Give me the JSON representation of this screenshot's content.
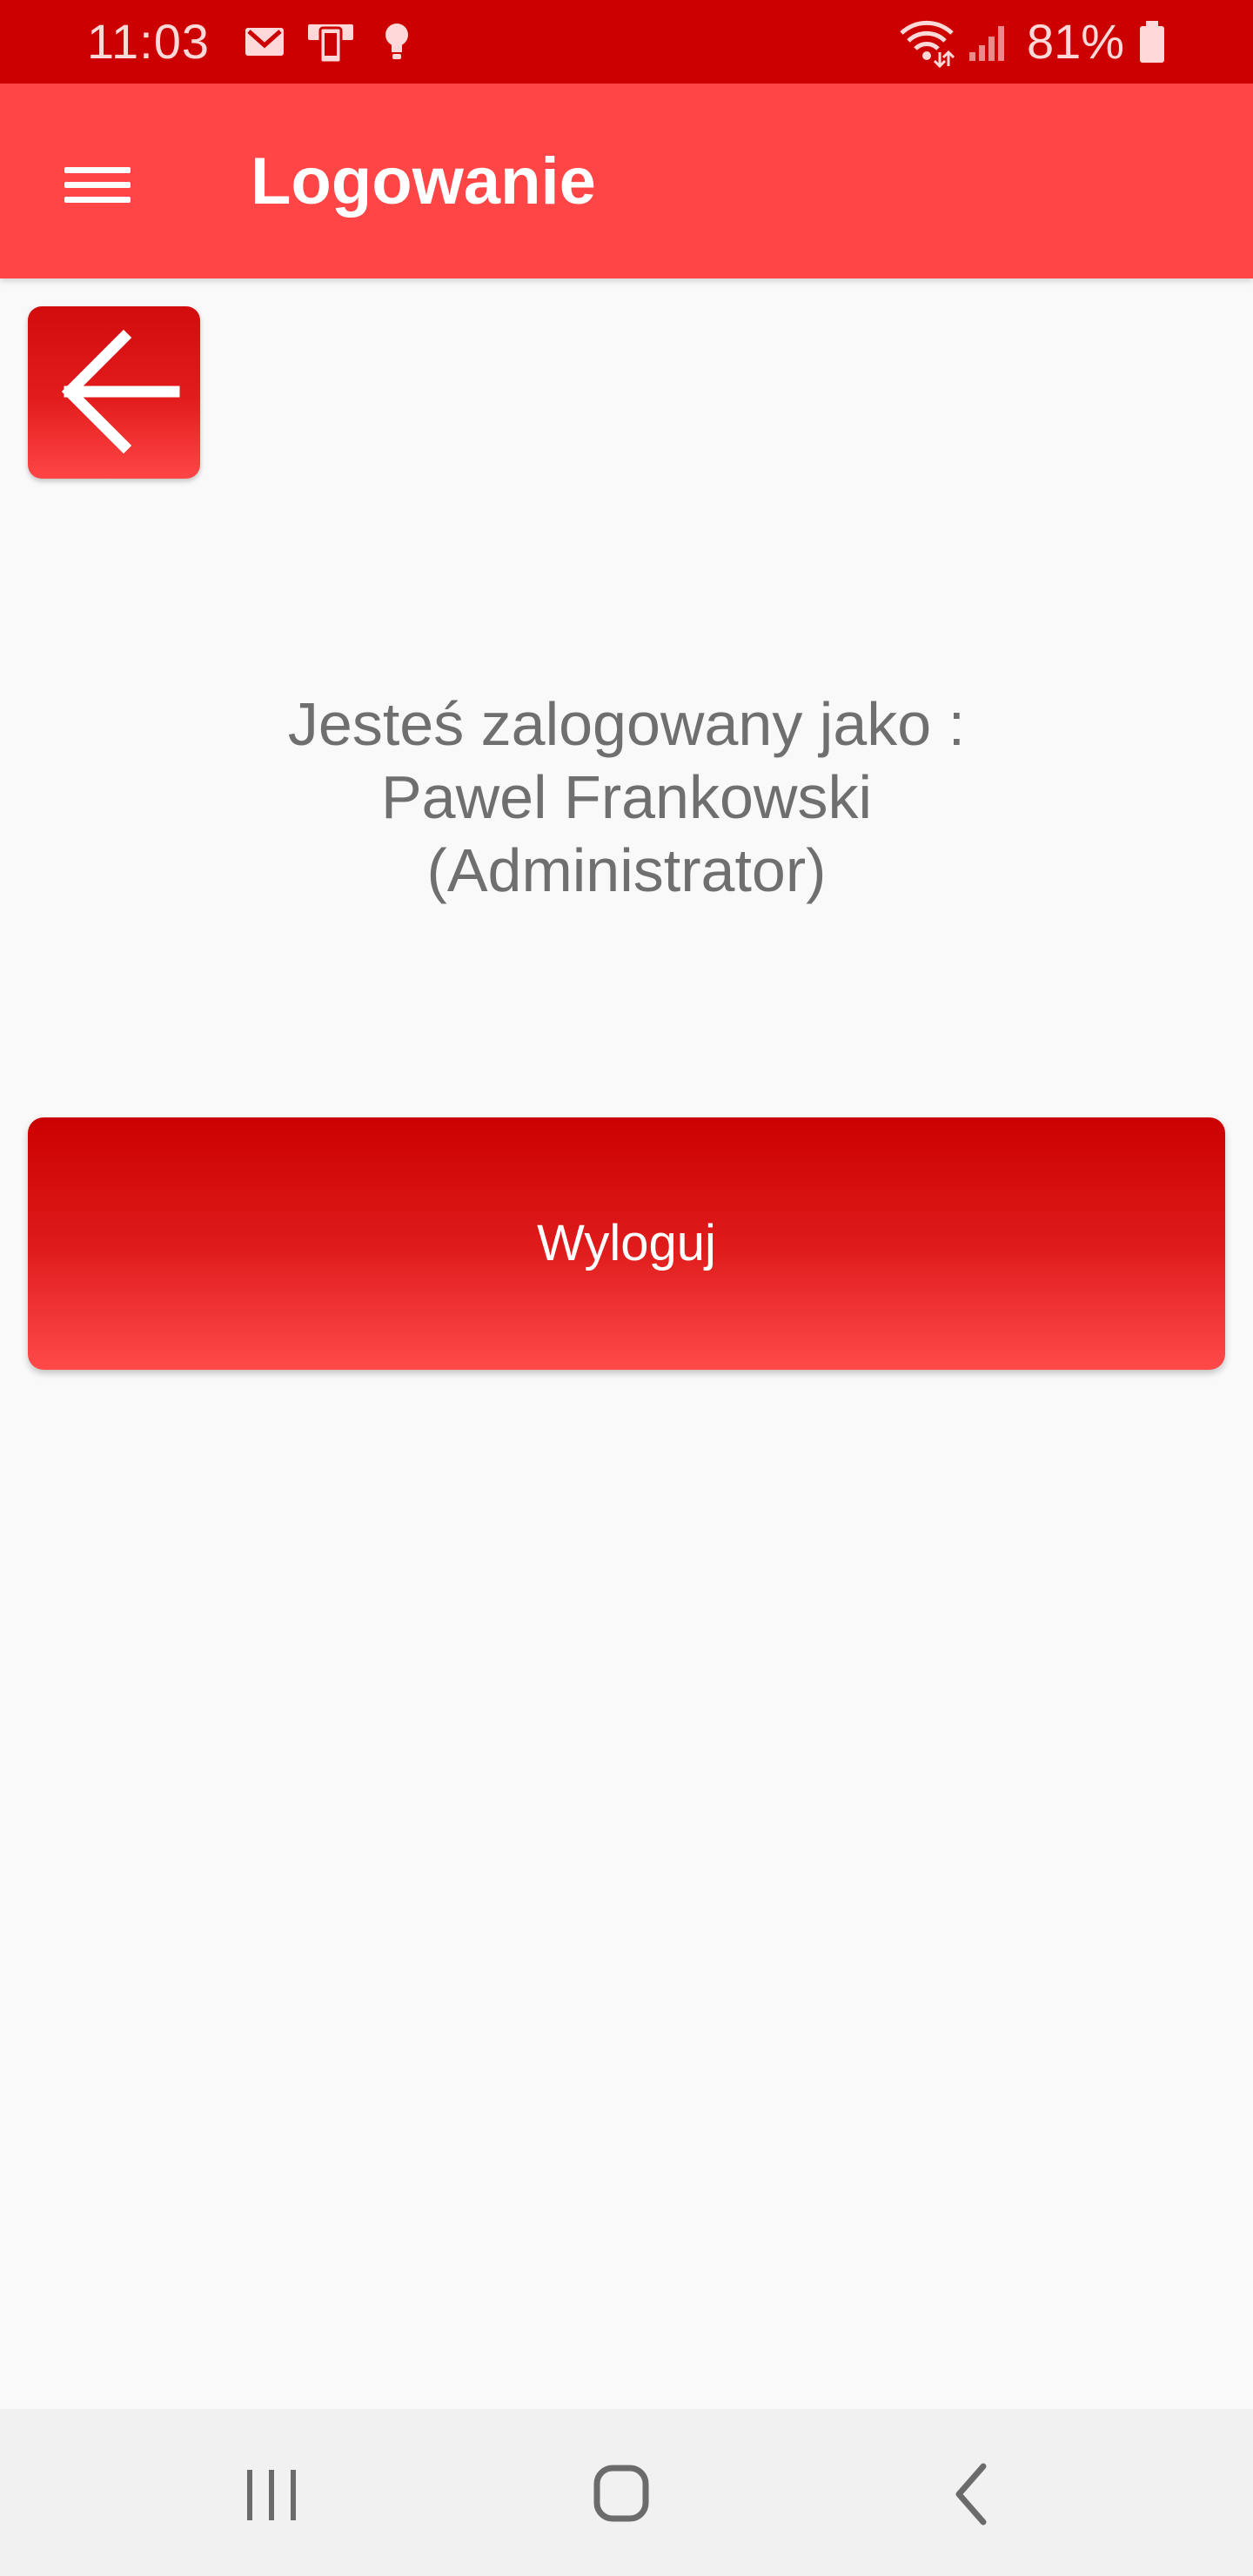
{
  "status_bar": {
    "time": "11:03",
    "battery": "81%",
    "icons": [
      "gmail-icon",
      "screen-mirror-icon",
      "lightbulb-icon",
      "wifi-icon",
      "signal-icon",
      "battery-icon"
    ],
    "background": "#cc0000"
  },
  "app_bar": {
    "title": "Logowanie",
    "menu_icon": "hamburger-menu-icon",
    "background": "#ff4545"
  },
  "back_button": {
    "icon": "arrow-left-icon"
  },
  "login_info": {
    "line1": "Jesteś zalogowany jako :",
    "line2": "Pawel Frankowski",
    "line3": "(Administrator)"
  },
  "logout_button": {
    "label": "Wyloguj",
    "accent": "#cc0000"
  },
  "nav_bar": {
    "icons": [
      "recent-apps-icon",
      "home-icon",
      "back-nav-icon"
    ]
  }
}
